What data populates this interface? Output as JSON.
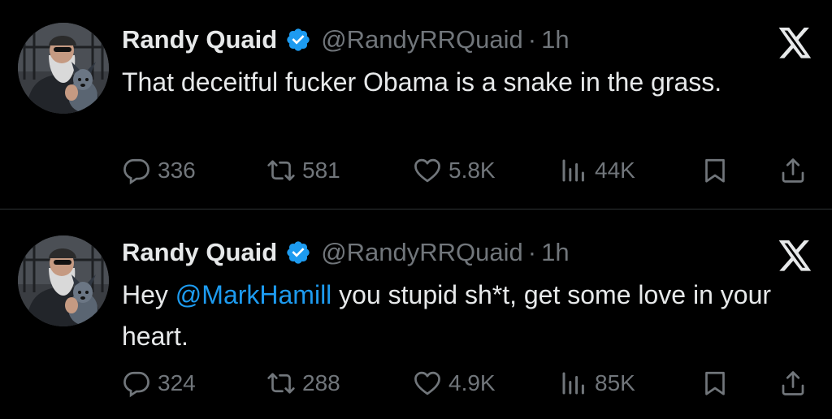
{
  "colors": {
    "background": "#000000",
    "text": "#e7e9ea",
    "secondary": "#71767b",
    "accent": "#1d9bf0",
    "divider": "#2f3336"
  },
  "tweets": [
    {
      "author": {
        "name": "Randy Quaid",
        "handle": "@RandyRRQuaid",
        "separator": "·",
        "time": "1h",
        "verified_icon": "verified-badge-icon"
      },
      "text_before": "That deceitful fucker Obama is a snake in the grass.",
      "mention": "",
      "text_after": "",
      "stats": {
        "replies": "336",
        "retweets": "581",
        "likes": "5.8K",
        "views": "44K"
      }
    },
    {
      "author": {
        "name": "Randy Quaid",
        "handle": "@RandyRRQuaid",
        "separator": "·",
        "time": "1h",
        "verified_icon": "verified-badge-icon"
      },
      "text_before": "Hey ",
      "mention": "@MarkHamill",
      "text_after": " you stupid sh*t, get some love in your heart.",
      "stats": {
        "replies": "324",
        "retweets": "288",
        "likes": "4.9K",
        "views": "85K"
      }
    }
  ],
  "icons": {
    "platform": "x-logo-icon",
    "reply": "reply-bubble-icon",
    "retweet": "retweet-icon",
    "like": "heart-icon",
    "views": "views-bar-chart-icon",
    "bookmark": "bookmark-icon",
    "share": "share-upload-icon"
  }
}
